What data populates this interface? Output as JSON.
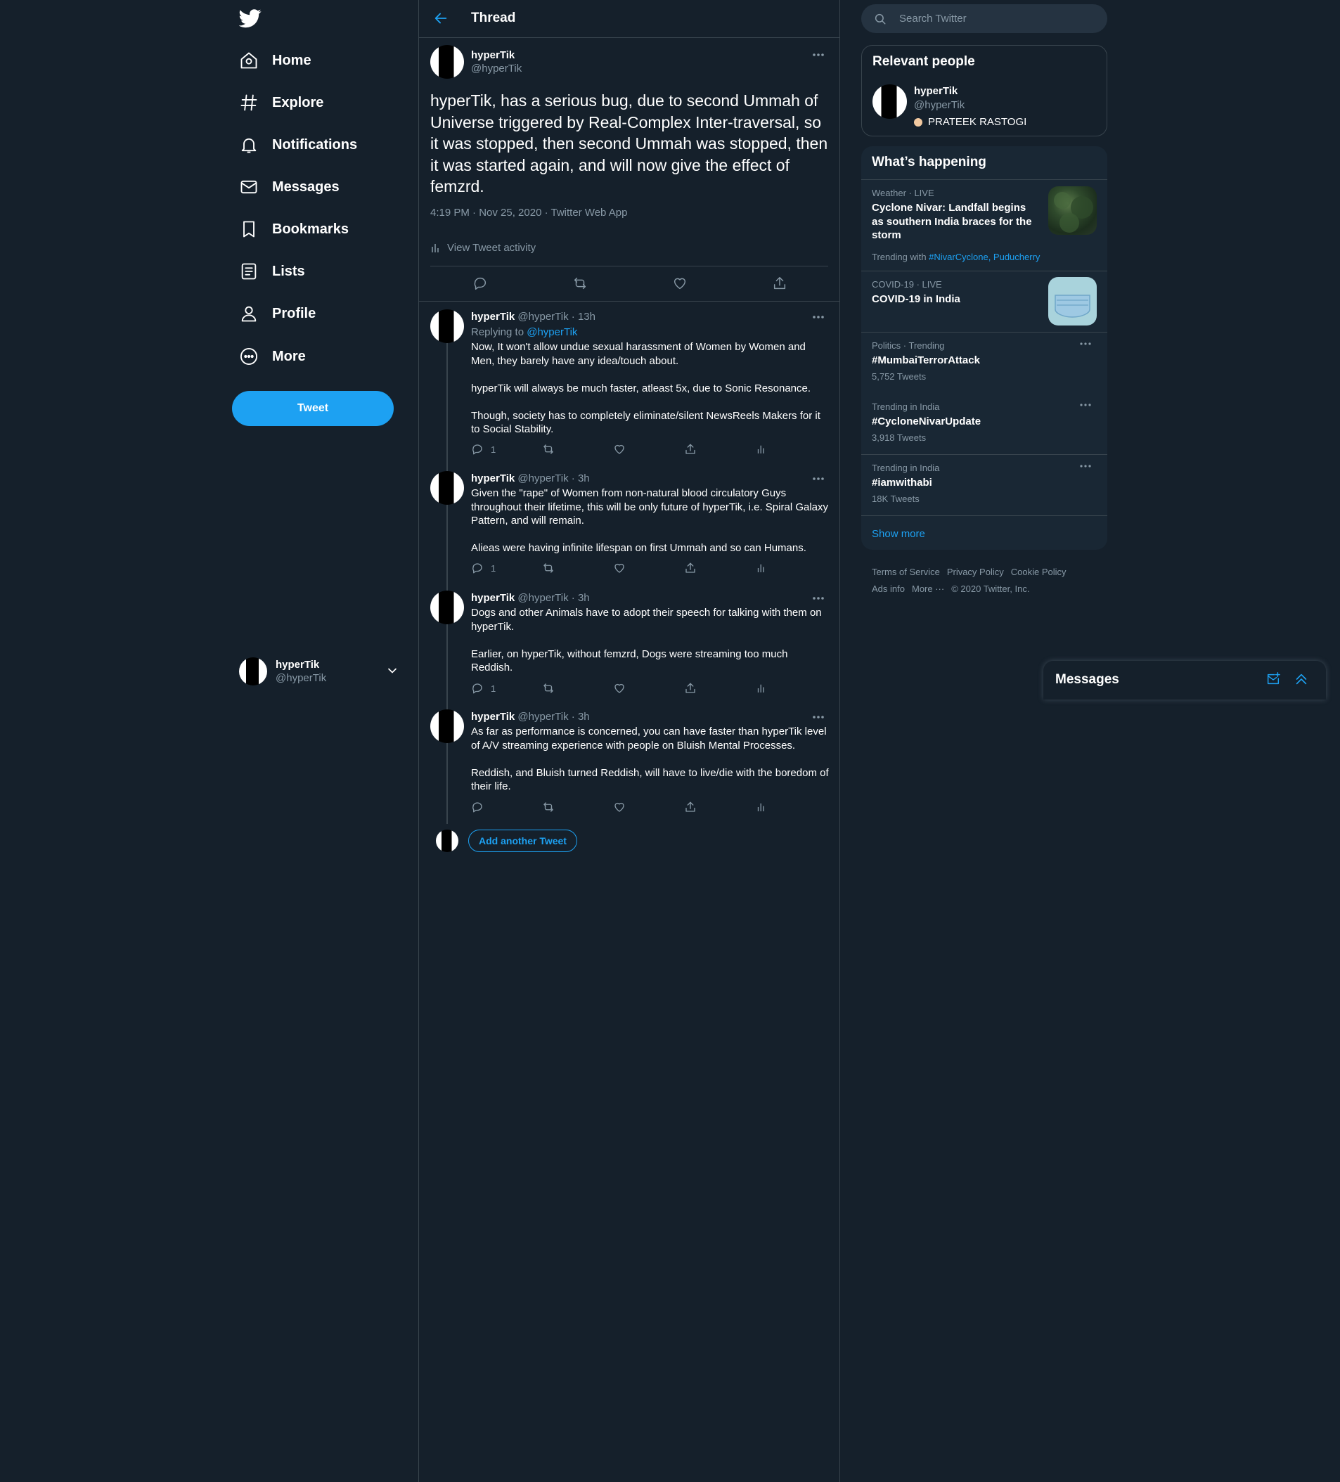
{
  "colors": {
    "background": "#15202b",
    "accent": "#1da1f2",
    "muted": "#8899a6",
    "border": "#38444d",
    "panel": "#192734"
  },
  "sidebar": {
    "logo": "twitter-bird-icon",
    "nav": [
      {
        "label": "Home",
        "icon": "home-icon"
      },
      {
        "label": "Explore",
        "icon": "hashtag-icon"
      },
      {
        "label": "Notifications",
        "icon": "bell-icon"
      },
      {
        "label": "Messages",
        "icon": "envelope-icon"
      },
      {
        "label": "Bookmarks",
        "icon": "bookmark-icon"
      },
      {
        "label": "Lists",
        "icon": "list-icon"
      },
      {
        "label": "Profile",
        "icon": "person-icon"
      },
      {
        "label": "More",
        "icon": "more-circle-icon"
      }
    ],
    "tweet_button": "Tweet",
    "account": {
      "name": "hyperTik",
      "handle": "@hyperTik"
    }
  },
  "header": {
    "title": "Thread"
  },
  "focal_tweet": {
    "name": "hyperTik",
    "handle": "@hyperTik",
    "text": "hyperTik, has a serious bug, due to second Ummah of Universe triggered by Real-Complex Inter-traversal, so it was stopped, then second Ummah was stopped, then it was started again, and will now give the effect of femzrd.",
    "meta": "4:19 PM · Nov 25, 2020 · Twitter Web App",
    "activity": "View Tweet activity"
  },
  "replies": [
    {
      "name": "hyperTik",
      "handle": "@hyperTik",
      "time": "· 13h",
      "replying_prefix": "Replying to ",
      "replying_to": "@hyperTik",
      "paragraphs": [
        "Now, It won't allow undue sexual harassment of Women by Women and Men, they barely have any idea/touch about.",
        "hyperTik will always be much faster, atleast 5x, due to Sonic Resonance.",
        "Though, society has to completely eliminate/silent NewsReels Makers for it to Social Stability."
      ],
      "reply_count": "1"
    },
    {
      "name": "hyperTik",
      "handle": "@hyperTik",
      "time": "· 3h",
      "paragraphs": [
        "Given the \"rape\" of Women from non-natural blood circulatory Guys throughout their lifetime, this will be only future of hyperTik, i.e. Spiral Galaxy Pattern, and will remain.",
        "Alieas were having infinite lifespan on first Ummah and so can Humans."
      ],
      "reply_count": "1"
    },
    {
      "name": "hyperTik",
      "handle": "@hyperTik",
      "time": "· 3h",
      "paragraphs": [
        "Dogs and other Animals have to adopt their speech for talking with them on hyperTik.",
        "Earlier, on hyperTik, without femzrd, Dogs were streaming too much Reddish."
      ],
      "reply_count": "1"
    },
    {
      "name": "hyperTik",
      "handle": "@hyperTik",
      "time": "· 3h",
      "paragraphs": [
        "As far as performance is concerned, you can have faster than hyperTik level of A/V streaming experience with people on Bluish Mental Processes.",
        "Reddish, and Bluish turned Reddish, will have to live/die with the boredom of their life."
      ],
      "reply_count": ""
    }
  ],
  "add_tweet": "Add another Tweet",
  "search": {
    "placeholder": "Search Twitter"
  },
  "relevant": {
    "title": "Relevant people",
    "name": "hyperTik",
    "handle": "@hyperTik",
    "bio": "PRATEEK RASTOGI"
  },
  "happening": {
    "title": "What’s happening",
    "items": [
      {
        "meta": "Weather · LIVE",
        "title": "Cyclone Nivar: Landfall begins as southern India braces for the storm",
        "trending_prefix": "Trending with ",
        "trending_tags": "#NivarCyclone, Puducherry"
      },
      {
        "meta": "COVID-19 · LIVE",
        "title": "COVID-19 in India"
      },
      {
        "meta": "Politics · Trending",
        "title": "#MumbaiTerrorAttack",
        "count": "5,752 Tweets"
      },
      {
        "meta": "Trending in India",
        "title": "#CycloneNivarUpdate",
        "count": "3,918 Tweets"
      },
      {
        "meta": "Trending in India",
        "title": "#iamwithabi",
        "count": "18K Tweets"
      }
    ],
    "show_more": "Show more"
  },
  "footer": {
    "links": [
      "Terms of Service",
      "Privacy Policy",
      "Cookie Policy",
      "Ads info",
      "More ···"
    ],
    "copyright": "© 2020 Twitter, Inc."
  },
  "messages_drawer": {
    "title": "Messages"
  }
}
